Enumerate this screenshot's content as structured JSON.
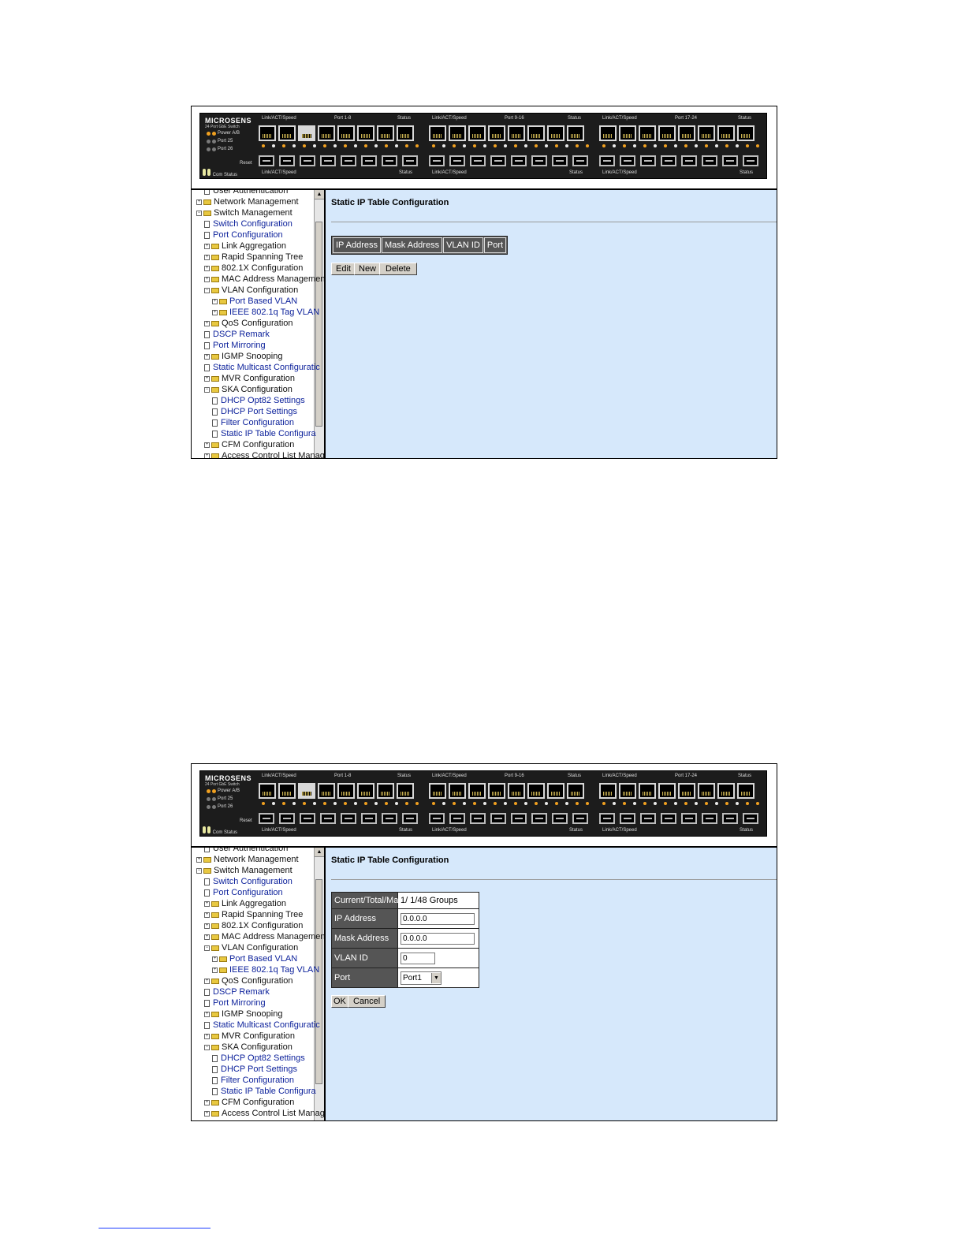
{
  "panel": {
    "brand": "MICROSENS",
    "subtitle": "24 Port GbE Switch",
    "power_label": "Power A/B",
    "port25_label": "Port 25",
    "port26_label": "Port 26",
    "reset_label": "Reset",
    "com_label": "Com",
    "status_label": "Status",
    "groups": [
      {
        "top_left": "Link/ACT/Speed",
        "port_range": "Port 1-8",
        "top_right": "Status",
        "bottom_left": "Link/ACT/Speed",
        "bottom_right": "Status"
      },
      {
        "top_left": "Link/ACT/Speed",
        "port_range": "Port 9-16",
        "top_right": "Status",
        "bottom_left": "Link/ACT/Speed",
        "bottom_right": "Status"
      },
      {
        "top_left": "Link/ACT/Speed",
        "port_range": "Port 17-24",
        "top_right": "Status",
        "bottom_left": "Link/ACT/Speed",
        "bottom_right": "Status"
      }
    ]
  },
  "nav": {
    "items": [
      {
        "label": "User Authentication",
        "type": "doc",
        "indent": 1
      },
      {
        "label": "Network Management",
        "type": "folder",
        "indent": 0
      },
      {
        "label": "Switch Management",
        "type": "folder-open",
        "indent": 0
      },
      {
        "label": "Switch Configuration",
        "type": "doc",
        "indent": 1
      },
      {
        "label": "Port Configuration",
        "type": "doc",
        "indent": 1
      },
      {
        "label": "Link Aggregation",
        "type": "folder",
        "indent": 1
      },
      {
        "label": "Rapid Spanning Tree",
        "type": "folder",
        "indent": 1
      },
      {
        "label": "802.1X Configuration",
        "type": "folder",
        "indent": 1
      },
      {
        "label": "MAC Address Managemen",
        "type": "folder",
        "indent": 1
      },
      {
        "label": "VLAN Configuration",
        "type": "folder-open",
        "indent": 1
      },
      {
        "label": "Port Based VLAN",
        "type": "folder",
        "indent": 2
      },
      {
        "label": "IEEE 802.1q Tag VLAN",
        "type": "folder",
        "indent": 2
      },
      {
        "label": "QoS Configuration",
        "type": "folder",
        "indent": 1
      },
      {
        "label": "DSCP Remark",
        "type": "doc",
        "indent": 1
      },
      {
        "label": "Port Mirroring",
        "type": "doc",
        "indent": 1
      },
      {
        "label": "IGMP Snooping",
        "type": "folder",
        "indent": 1
      },
      {
        "label": "Static Multicast Configuratic",
        "type": "doc",
        "indent": 1
      },
      {
        "label": "MVR Configuration",
        "type": "folder",
        "indent": 1
      },
      {
        "label": "SKA Configuration",
        "type": "folder-open",
        "indent": 1
      },
      {
        "label": "DHCP Opt82 Settings",
        "type": "doc",
        "indent": 2
      },
      {
        "label": "DHCP Port Settings",
        "type": "doc",
        "indent": 2
      },
      {
        "label": "Filter Configuration",
        "type": "doc",
        "indent": 2
      },
      {
        "label": "Static IP Table Configura",
        "type": "doc",
        "indent": 2
      },
      {
        "label": "CFM Configuration",
        "type": "folder",
        "indent": 1
      },
      {
        "label": "Access Control List Manage",
        "type": "folder",
        "indent": 1
      }
    ]
  },
  "screen1": {
    "title": "Static IP Table Configuration",
    "columns": [
      "IP Address",
      "Mask Address",
      "VLAN ID",
      "Port"
    ],
    "buttons": {
      "edit": "Edit",
      "new": "New",
      "delete": "Delete"
    }
  },
  "screen2": {
    "title": "Static IP Table Configuration",
    "rows": {
      "current_label": "Current/Total/Max",
      "current_value": "1/ 1/48 Groups",
      "ip_label": "IP Address",
      "ip_value": "0.0.0.0",
      "mask_label": "Mask Address",
      "mask_value": "0.0.0.0",
      "vlan_label": "VLAN ID",
      "vlan_value": "0",
      "port_label": "Port",
      "port_value": "Port1"
    },
    "buttons": {
      "ok": "OK",
      "cancel": "Cancel"
    }
  }
}
